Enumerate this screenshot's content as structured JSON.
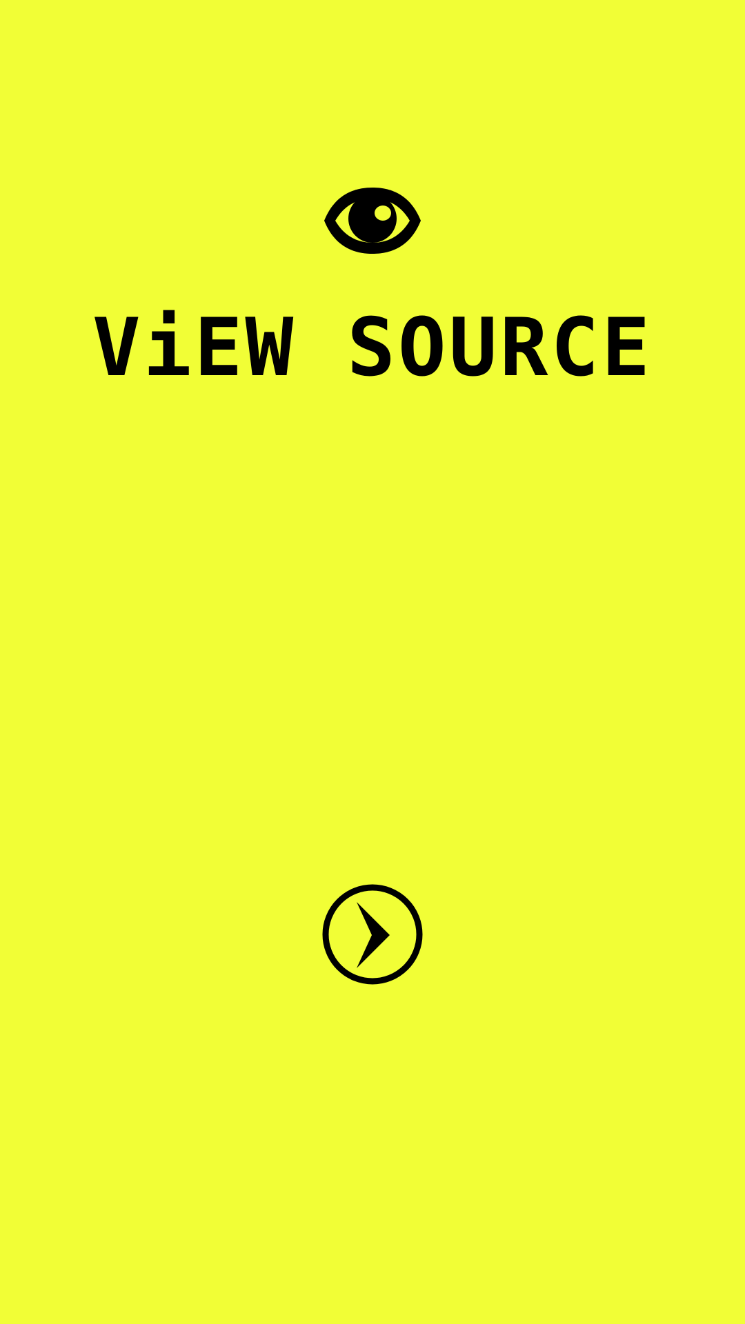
{
  "app": {
    "title": "ViEW SOURCE"
  },
  "icons": {
    "top": "eye-icon",
    "button": "play-arrow-icon"
  },
  "colors": {
    "background": "#f1fe36",
    "foreground": "#000000"
  }
}
